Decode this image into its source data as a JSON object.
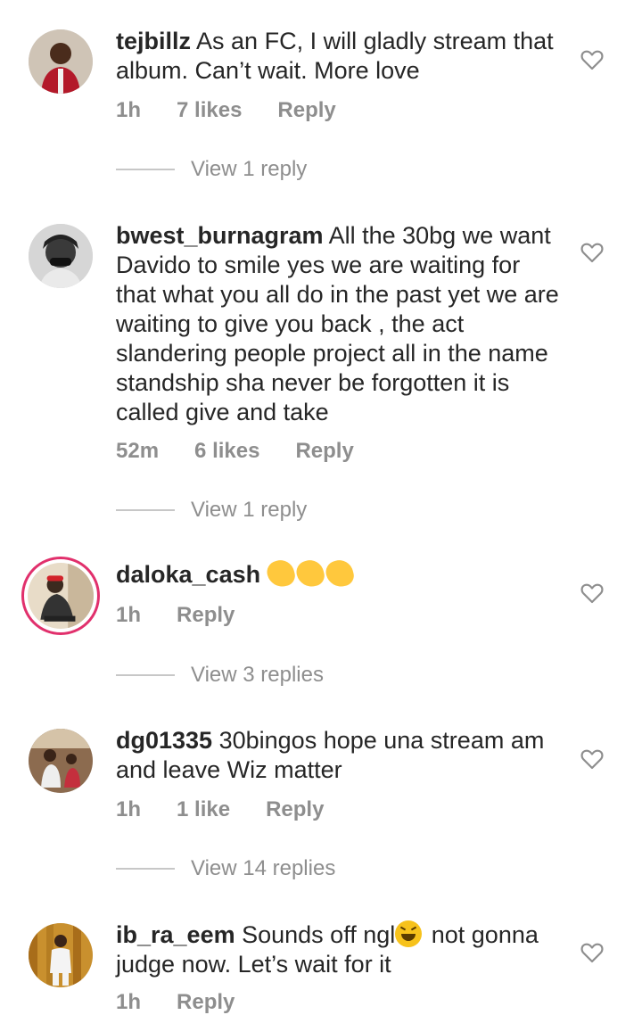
{
  "colors": {
    "text": "#262626",
    "muted": "#8e8e8e",
    "story_ring": "#e1306c"
  },
  "icons": {
    "like": "heart-outline-icon"
  },
  "comments": [
    {
      "username": "tejbillz",
      "text": "As an FC, I will gladly stream that album. Can’t wait. More love",
      "time": "1h",
      "likes": "7 likes",
      "reply": "Reply",
      "view_replies": "View 1 reply"
    },
    {
      "username": "bwest_burnagram",
      "text": "All the 30bg we want Davido to smile yes we are waiting for that what you all do in the past yet we are waiting to give you back , the act slandering people project all in the name standship sha never be forgotten it is called give and take",
      "time": "52m",
      "likes": "6 likes",
      "reply": "Reply",
      "view_replies": "View 1 reply"
    },
    {
      "username": "daloka_cash",
      "text": "",
      "emoji": "clapping-hands-emoji x3",
      "time": "1h",
      "reply": "Reply",
      "view_replies": "View 3 replies"
    },
    {
      "username": "dg01335",
      "text": "30bingos hope una stream am and leave Wiz matter",
      "time": "1h",
      "likes": "1 like",
      "reply": "Reply",
      "view_replies": "View 14 replies"
    },
    {
      "username": "ib_ra_eem",
      "text_a": "Sounds off ngl",
      "emoji": "laughing-squinting-face-emoji",
      "text_b": " not gonna judge now. Let’s wait for it",
      "time": "1h",
      "reply": "Reply"
    }
  ]
}
